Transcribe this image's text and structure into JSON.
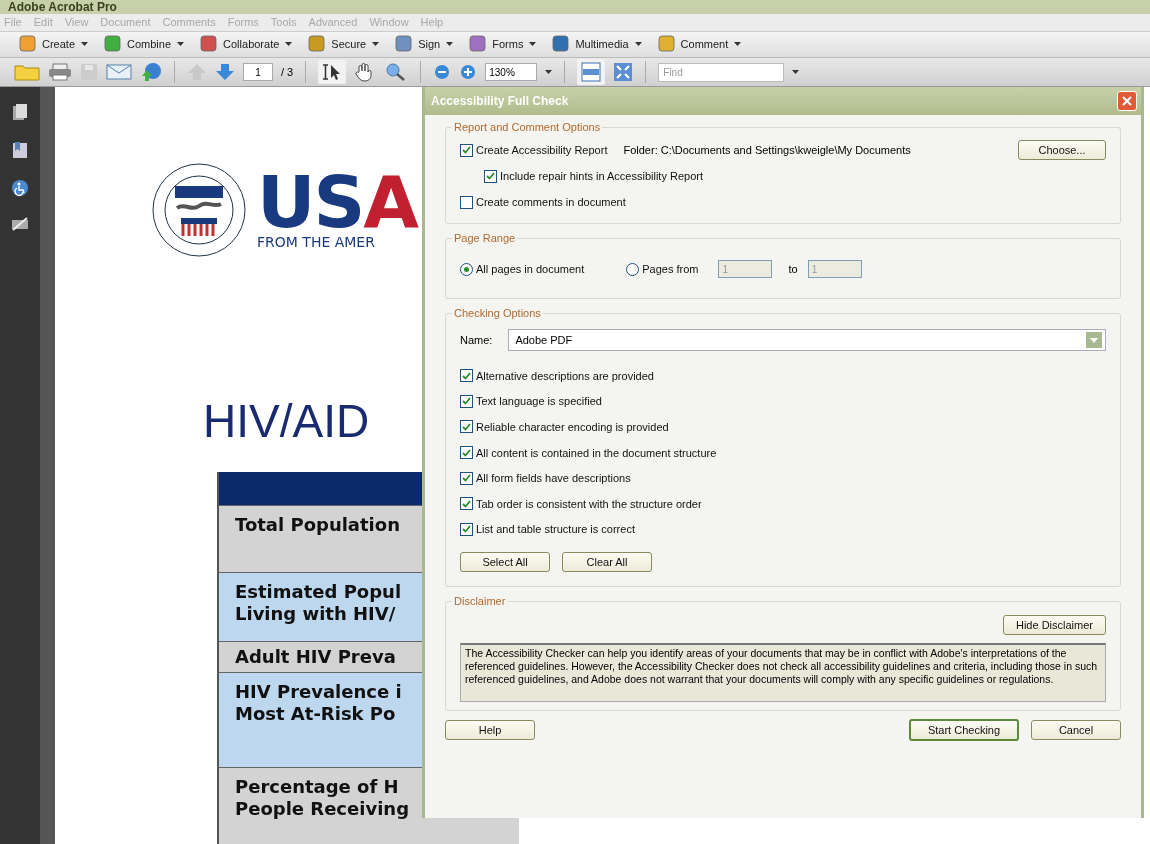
{
  "window": {
    "title": "Adobe Acrobat Pro"
  },
  "menu": [
    {
      "label": "File",
      "disabled": true
    },
    {
      "label": "Edit",
      "disabled": true
    },
    {
      "label": "View",
      "disabled": true
    },
    {
      "label": "Document",
      "disabled": true
    },
    {
      "label": "Comments",
      "disabled": true
    },
    {
      "label": "Forms",
      "disabled": true
    },
    {
      "label": "Tools",
      "disabled": true
    },
    {
      "label": "Advanced",
      "disabled": true
    },
    {
      "label": "Window",
      "disabled": true
    },
    {
      "label": "Help",
      "disabled": true
    }
  ],
  "tasks": [
    "Create",
    "Combine",
    "Collaborate",
    "Secure",
    "Sign",
    "Forms",
    "Multimedia",
    "Comment"
  ],
  "nav": {
    "page": "1",
    "page_count": "/ 3",
    "zoom": "130%",
    "find_placeholder": "Find"
  },
  "document": {
    "wordmark": "USA",
    "tagline": "FROM THE AMER",
    "heading": "HIV/AID",
    "rows": [
      {
        "lines": [
          "Total Population"
        ],
        "color": "#d3d3d3"
      },
      {
        "lines": [
          "Estimated Popul",
          "Living with HIV/"
        ],
        "color": "#bdd7ee"
      },
      {
        "lines": [
          "Adult HIV Preva"
        ],
        "color": "#d3d3d3"
      },
      {
        "lines": [
          "HIV Prevalence i",
          "Most At-Risk Po"
        ],
        "color": "#bdd7ee"
      },
      {
        "lines": [
          "Percentage of H",
          "People Receiving"
        ],
        "color": "#d3d3d3"
      }
    ]
  },
  "dialog": {
    "title": "Accessibility Full Check",
    "report": {
      "legend": "Report and Comment Options",
      "create_report": {
        "label": "Create Accessibility Report",
        "checked": true
      },
      "folder": "Folder: C:\\Documents and Settings\\kweigle\\My Documents",
      "choose": "Choose...",
      "repair_hints": {
        "label": "Include repair hints in Accessibility Report",
        "checked": true
      },
      "create_comments": {
        "label": "Create comments in document",
        "checked": false
      }
    },
    "page_range": {
      "legend": "Page Range",
      "options": [
        {
          "label": "All pages in document",
          "selected": true
        },
        {
          "label": "Pages from",
          "selected": false
        }
      ],
      "from": "1",
      "to_label": "to",
      "to": "1",
      "disabled": true
    },
    "checking": {
      "legend": "Checking Options",
      "name_label": "Name:",
      "name_value": "Adobe PDF",
      "checks": [
        {
          "label": "Alternative descriptions are provided",
          "checked": true
        },
        {
          "label": "Text language is specified",
          "checked": true
        },
        {
          "label": "Reliable character encoding is provided",
          "checked": true
        },
        {
          "label": "All content is contained in the document structure",
          "checked": true
        },
        {
          "label": "All form fields have descriptions",
          "checked": true
        },
        {
          "label": "Tab order is consistent with the structure order",
          "checked": true
        },
        {
          "label": "List and table structure is correct",
          "checked": true
        }
      ],
      "select_all": "Select All",
      "clear_all": "Clear All"
    },
    "disclaimer": {
      "legend": "Disclaimer",
      "button": "Hide Disclaimer",
      "text": "The Accessibility Checker can help you identify areas of your documents that may be in conflict with Adobe's interpretations of the referenced guidelines. However, the Accessibility Checker does not check all accessibility guidelines and criteria, including those in such referenced guidelines, and Adobe does not warrant that your documents will comply with any specific guidelines or regulations."
    },
    "help": "Help",
    "start": "Start Checking",
    "cancel": "Cancel"
  }
}
